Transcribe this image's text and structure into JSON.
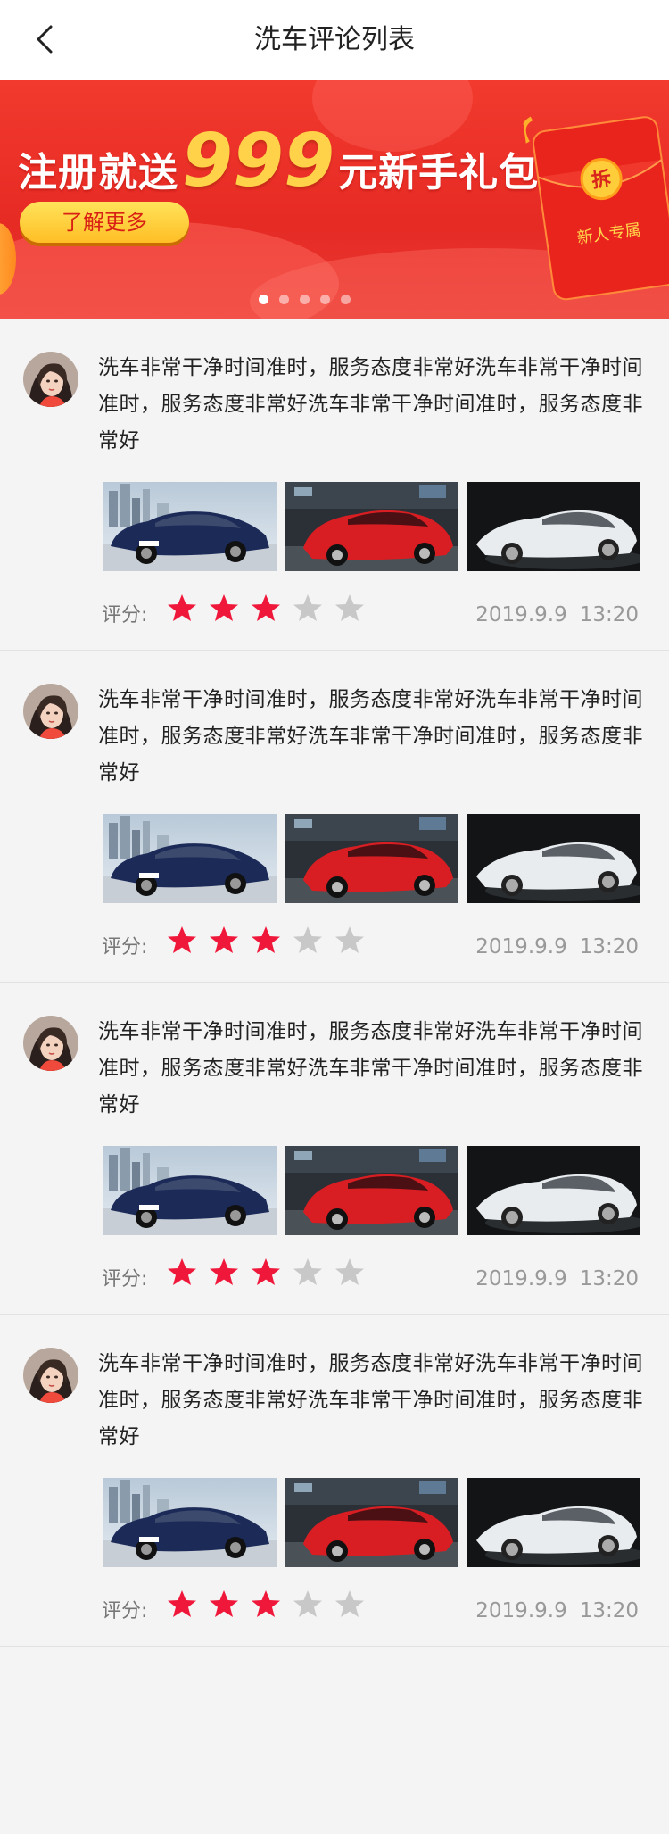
{
  "header": {
    "title": "洗车评论列表",
    "back_icon": "chevron-left-icon"
  },
  "banner": {
    "headline_prefix": "注册就送",
    "headline_number": "999",
    "headline_suffix": "元新手礼包",
    "button_label": "了解更多",
    "envelope_seal": "拆",
    "envelope_label": "新人专属",
    "slide_count": 5,
    "active_slide": 1,
    "colors": {
      "background": "#e62a24",
      "headline_number": "#ffd24a",
      "button": "#ffc62e"
    }
  },
  "reviews": [
    {
      "text": "洗车非常干净时间准时，服务态度非常好洗车非常干净时间准时，服务态度非常好洗车非常干净时间准时，服务态度非常好",
      "photos": [
        "dark-blue-sedan",
        "red-sports-car",
        "white-supercar"
      ],
      "rating_label": "评分:",
      "rating": 3,
      "rating_max": 5,
      "date": "2019.9.9",
      "time": "13:20"
    },
    {
      "text": "洗车非常干净时间准时，服务态度非常好洗车非常干净时间准时，服务态度非常好洗车非常干净时间准时，服务态度非常好",
      "photos": [
        "dark-blue-sedan",
        "red-sports-car",
        "white-supercar"
      ],
      "rating_label": "评分:",
      "rating": 3,
      "rating_max": 5,
      "date": "2019.9.9",
      "time": "13:20"
    },
    {
      "text": "洗车非常干净时间准时，服务态度非常好洗车非常干净时间准时，服务态度非常好洗车非常干净时间准时，服务态度非常好",
      "photos": [
        "dark-blue-sedan",
        "red-sports-car",
        "white-supercar"
      ],
      "rating_label": "评分:",
      "rating": 3,
      "rating_max": 5,
      "date": "2019.9.9",
      "time": "13:20"
    },
    {
      "text": "洗车非常干净时间准时，服务态度非常好洗车非常干净时间准时，服务态度非常好洗车非常干净时间准时，服务态度非常好",
      "photos": [
        "dark-blue-sedan",
        "red-sports-car",
        "white-supercar"
      ],
      "rating_label": "评分:",
      "rating": 3,
      "rating_max": 5,
      "date": "2019.9.9",
      "time": "13:20"
    }
  ],
  "colors": {
    "star_filled": "#f0183a",
    "star_empty": "#c8c8c8",
    "page_background": "#f4f4f4"
  }
}
